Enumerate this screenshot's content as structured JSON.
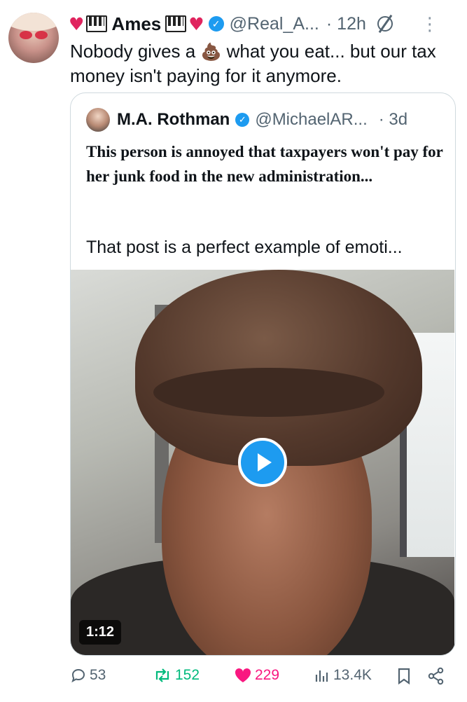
{
  "author": {
    "display_name": "Ames",
    "handle": "@Real_A...",
    "time": "· 12h"
  },
  "tweet": {
    "text_part1": "Nobody gives a",
    "text_emoji": "💩",
    "text_part2": " what you eat... but our tax money isn't  paying for it anymore."
  },
  "quote": {
    "display_name": "M.A. Rothman",
    "handle": "@MichaelAR...",
    "time": "· 3d",
    "bold_text": "This person is annoyed that taxpayers won't pay for her junk food in the new administration...",
    "text": "That post is a perfect example of emoti...",
    "video_duration": "1:12"
  },
  "actions": {
    "replies": "53",
    "retweets": "152",
    "likes": "229",
    "views": "13.4K"
  },
  "colors": {
    "accent": "#1d9bf0",
    "retweet": "#00ba7c",
    "like": "#f91880",
    "muted": "#536471"
  }
}
